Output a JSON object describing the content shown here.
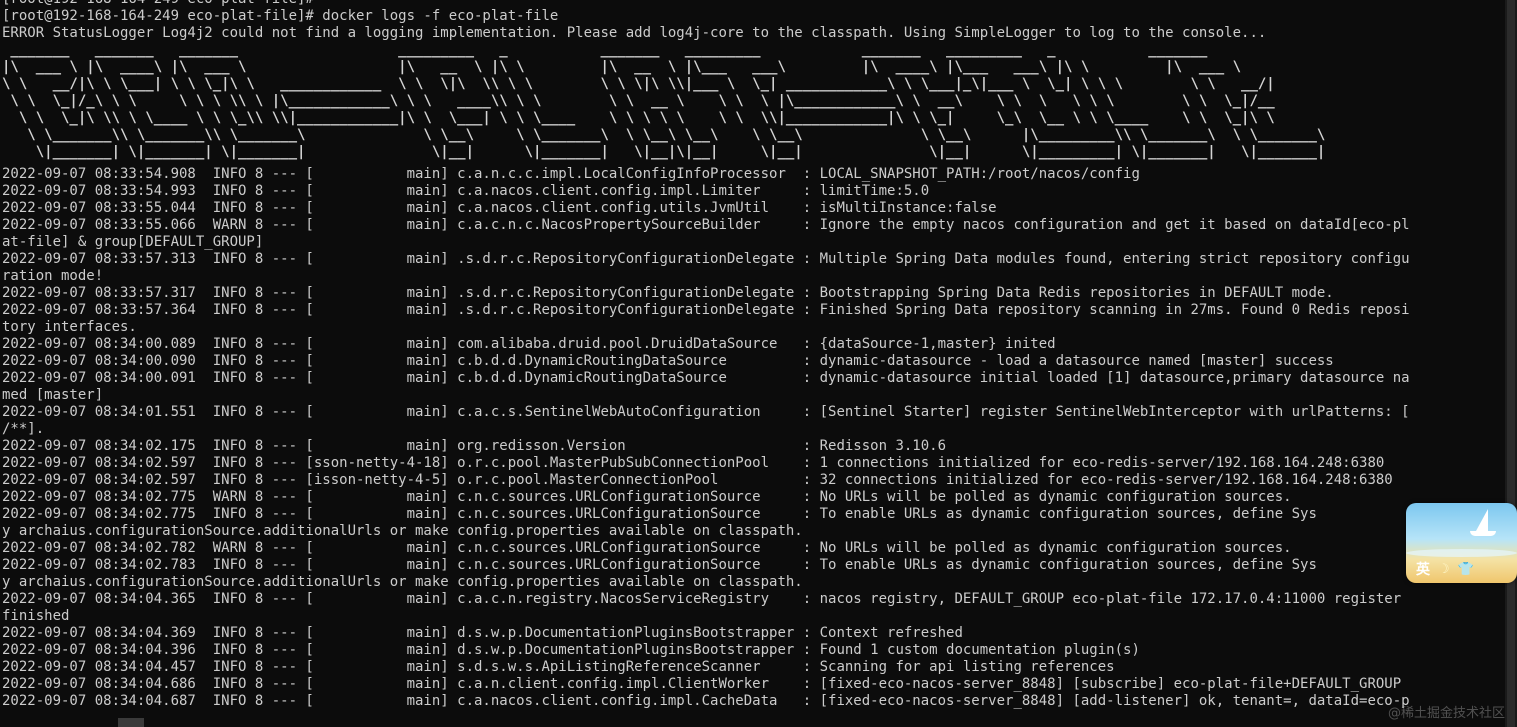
{
  "terminal": {
    "partial_top": "[root@192-168-164-249 eco-plat-file]#",
    "prompt": "[root@192-168-164-249 eco-plat-file]# docker logs -f eco-plat-file",
    "error_line": "ERROR StatusLogger Log4j2 could not find a logging implementation. Please add log4j-core to the classpath. Using SimpleLogger to log to the console...",
    "banner": [
      " _______   _______   _______                   _________   _           _______   _________            _______   _________   _           _______ ",
      "|\\  ___ \\ |\\  ____\\ |\\  ___ \\                  |\\   __  \\ |\\ \\         |\\  __  \\ |\\___   ___\\         |\\  ____\\ |\\___   ___\\ |\\ \\         |\\  ___ \\ ",
      "\\ \\   __/|\\ \\ \\___| \\ \\ \\_|\\ \\   ____________  \\ \\  \\|\\  \\\\ \\ \\        \\ \\ \\|\\ \\\\|___ \\  \\_| ____________\\ \\ \\___|_\\|___ \\  \\_| \\ \\ \\        \\ \\   __/|",
      " \\ \\  \\_|/_\\ \\ \\     \\ \\ \\ \\\\ \\ |\\____________\\ \\ \\   ____\\\\ \\ \\        \\ \\  __ \\    \\ \\  \\ |\\____________\\ \\  __\\    \\ \\  \\   \\ \\ \\        \\ \\  \\_|/__",
      "  \\ \\  \\_|\\ \\\\ \\ \\____ \\ \\ \\_\\\\ \\\\|____________|\\ \\  \\___| \\ \\ \\____    \\ \\ \\ \\ \\    \\ \\  \\\\|____________|\\ \\ \\_|     \\_\\  \\__ \\ \\ \\____    \\ \\  \\_|\\ \\",
      "   \\ \\_______\\\\ \\_______\\\\ \\_______\\              \\ \\__\\     \\ \\_______\\  \\ \\__\\ \\__\\    \\ \\__\\              \\ \\__\\      |\\_________\\\\ \\_______\\  \\ \\_______\\",
      "    \\|_______| \\|_______| \\|_______|               \\|__|      \\|_______|   \\|__|\\|__|     \\|__|               \\|__|      \\|_________| \\|_______|   \\|_______|"
    ],
    "log_lines": [
      "2022-09-07 08:33:54.908  INFO 8 --- [           main] c.a.n.c.c.impl.LocalConfigInfoProcessor  : LOCAL_SNAPSHOT_PATH:/root/nacos/config",
      "2022-09-07 08:33:54.993  INFO 8 --- [           main] c.a.nacos.client.config.impl.Limiter     : limitTime:5.0",
      "2022-09-07 08:33:55.044  INFO 8 --- [           main] c.a.nacos.client.config.utils.JvmUtil    : isMultiInstance:false",
      "2022-09-07 08:33:55.066  WARN 8 --- [           main] c.a.c.n.c.NacosPropertySourceBuilder     : Ignore the empty nacos configuration and get it based on dataId[eco-pl",
      "at-file] & group[DEFAULT_GROUP]",
      "2022-09-07 08:33:57.313  INFO 8 --- [           main] .s.d.r.c.RepositoryConfigurationDelegate : Multiple Spring Data modules found, entering strict repository configu",
      "ration mode!",
      "2022-09-07 08:33:57.317  INFO 8 --- [           main] .s.d.r.c.RepositoryConfigurationDelegate : Bootstrapping Spring Data Redis repositories in DEFAULT mode.",
      "2022-09-07 08:33:57.364  INFO 8 --- [           main] .s.d.r.c.RepositoryConfigurationDelegate : Finished Spring Data repository scanning in 27ms. Found 0 Redis reposi",
      "tory interfaces.",
      "2022-09-07 08:34:00.089  INFO 8 --- [           main] com.alibaba.druid.pool.DruidDataSource   : {dataSource-1,master} inited",
      "2022-09-07 08:34:00.090  INFO 8 --- [           main] c.b.d.d.DynamicRoutingDataSource         : dynamic-datasource - load a datasource named [master] success",
      "2022-09-07 08:34:00.091  INFO 8 --- [           main] c.b.d.d.DynamicRoutingDataSource         : dynamic-datasource initial loaded [1] datasource,primary datasource na",
      "med [master]",
      "2022-09-07 08:34:01.551  INFO 8 --- [           main] c.a.c.s.SentinelWebAutoConfiguration     : [Sentinel Starter] register SentinelWebInterceptor with urlPatterns: [",
      "/**].",
      "2022-09-07 08:34:02.175  INFO 8 --- [           main] org.redisson.Version                     : Redisson 3.10.6",
      "2022-09-07 08:34:02.597  INFO 8 --- [sson-netty-4-18] o.r.c.pool.MasterPubSubConnectionPool    : 1 connections initialized for eco-redis-server/192.168.164.248:6380",
      "2022-09-07 08:34:02.597  INFO 8 --- [isson-netty-4-5] o.r.c.pool.MasterConnectionPool          : 32 connections initialized for eco-redis-server/192.168.164.248:6380",
      "2022-09-07 08:34:02.775  WARN 8 --- [           main] c.n.c.sources.URLConfigurationSource     : No URLs will be polled as dynamic configuration sources.",
      "2022-09-07 08:34:02.775  INFO 8 --- [           main] c.n.c.sources.URLConfigurationSource     : To enable URLs as dynamic configuration sources, define Sys",
      "y archaius.configurationSource.additionalUrls or make config.properties available on classpath.",
      "2022-09-07 08:34:02.782  WARN 8 --- [           main] c.n.c.sources.URLConfigurationSource     : No URLs will be polled as dynamic configuration sources.",
      "2022-09-07 08:34:02.783  INFO 8 --- [           main] c.n.c.sources.URLConfigurationSource     : To enable URLs as dynamic configuration sources, define Sys",
      "y archaius.configurationSource.additionalUrls or make config.properties available on classpath.",
      "2022-09-07 08:34:04.365  INFO 8 --- [           main] c.a.c.n.registry.NacosServiceRegistry    : nacos registry, DEFAULT_GROUP eco-plat-file 172.17.0.4:11000 register",
      "finished",
      "2022-09-07 08:34:04.369  INFO 8 --- [           main] d.s.w.p.DocumentationPluginsBootstrapper : Context refreshed",
      "2022-09-07 08:34:04.396  INFO 8 --- [           main] d.s.w.p.DocumentationPluginsBootstrapper : Found 1 custom documentation plugin(s)",
      "2022-09-07 08:34:04.457  INFO 8 --- [           main] s.d.s.w.s.ApiListingReferenceScanner     : Scanning for api listing references",
      "2022-09-07 08:34:04.686  INFO 8 --- [           main] c.a.n.client.config.impl.ClientWorker    : [fixed-eco-nacos-server_8848] [subscribe] eco-plat-file+DEFAULT_GROUP",
      "2022-09-07 08:34:04.687  INFO 8 --- [           main] c.a.nacos.client.config.impl.CacheData   : [fixed-eco-nacos-server_8848] [add-listener] ok, tenant=, dataId=eco-p"
    ]
  },
  "ime": {
    "mode_label": "英",
    "moon_icon": "☽",
    "shirt_icon": "👕"
  },
  "watermark": "@稀土掘金技术社区",
  "colors": {
    "background": "#0c0c0c",
    "foreground": "#cccccc"
  }
}
